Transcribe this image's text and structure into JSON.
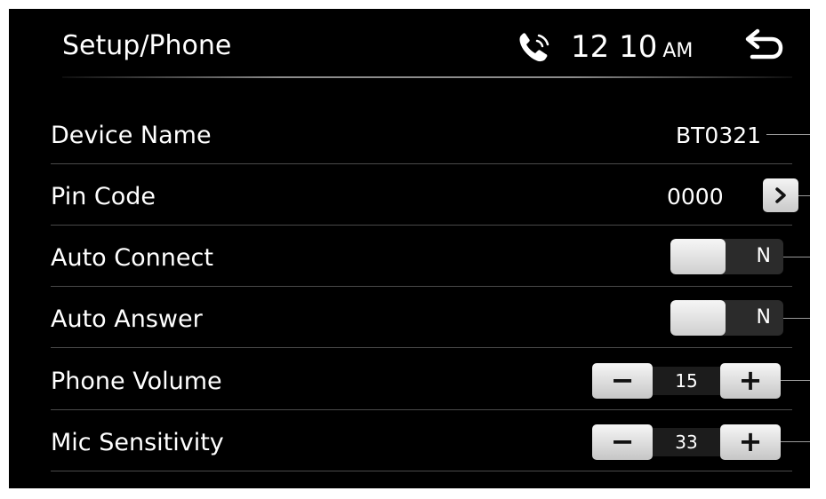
{
  "header": {
    "title": "Setup/Phone",
    "time": "12 10",
    "ampm": "AM",
    "phone_icon": "phone-bluetooth-icon",
    "back_icon": "back-arrow-icon"
  },
  "settings": [
    {
      "label": "Device Name",
      "value": "BT0321"
    },
    {
      "label": "Pin Code",
      "value": "0000",
      "action_icon": "chevron-right-icon"
    },
    {
      "label": "Auto Connect",
      "state": "N"
    },
    {
      "label": "Auto Answer",
      "state": "N"
    },
    {
      "label": "Phone Volume",
      "value": "15",
      "decrement": "−",
      "increment": "+"
    },
    {
      "label": "Mic Sensitivity",
      "value": "33",
      "decrement": "−",
      "increment": "+"
    }
  ],
  "colors": {
    "background": "#000000",
    "text": "#ffffff",
    "button": "#d9d9d9",
    "divider": "#4a4a4a"
  }
}
